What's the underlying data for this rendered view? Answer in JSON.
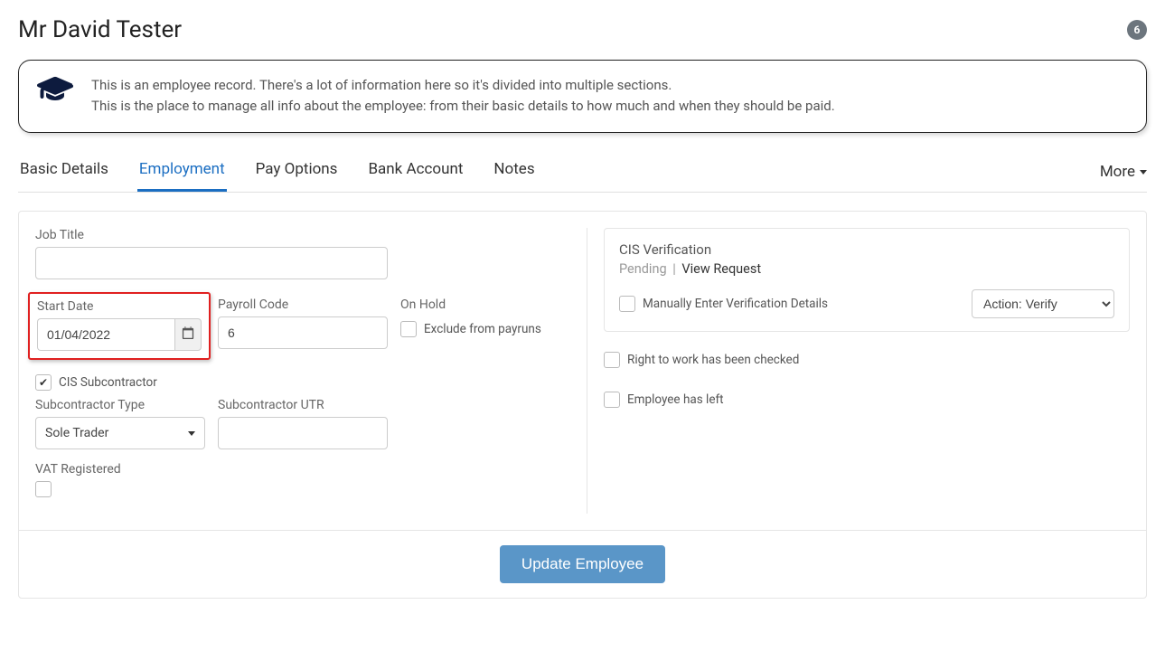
{
  "header": {
    "title": "Mr David Tester",
    "badge": "6"
  },
  "info": {
    "line1": "This is an employee record. There's a lot of information here so it's divided into multiple sections.",
    "line2": "This is the place to manage all info about the employee: from their basic details to how much and when they should be paid."
  },
  "tabs": {
    "items": [
      {
        "label": "Basic Details"
      },
      {
        "label": "Employment"
      },
      {
        "label": "Pay Options"
      },
      {
        "label": "Bank Account"
      },
      {
        "label": "Notes"
      }
    ],
    "more": "More"
  },
  "form": {
    "jobTitle": {
      "label": "Job Title",
      "value": ""
    },
    "startDate": {
      "label": "Start Date",
      "value": "01/04/2022"
    },
    "payrollCode": {
      "label": "Payroll Code",
      "value": "6"
    },
    "onHold": {
      "label": "On Hold",
      "checkLabel": "Exclude from payruns"
    },
    "cisSub": {
      "label": "CIS Subcontractor"
    },
    "subType": {
      "label": "Subcontractor Type",
      "value": "Sole Trader"
    },
    "subUtr": {
      "label": "Subcontractor UTR",
      "value": ""
    },
    "vat": {
      "label": "VAT Registered"
    }
  },
  "cis": {
    "title": "CIS Verification",
    "status": "Pending",
    "link": "View Request",
    "manualLabel": "Manually Enter Verification Details",
    "action": "Action: Verify"
  },
  "rightChecks": {
    "rightToWork": "Right to work has been checked",
    "employeeLeft": "Employee has left"
  },
  "footer": {
    "submit": "Update Employee"
  }
}
